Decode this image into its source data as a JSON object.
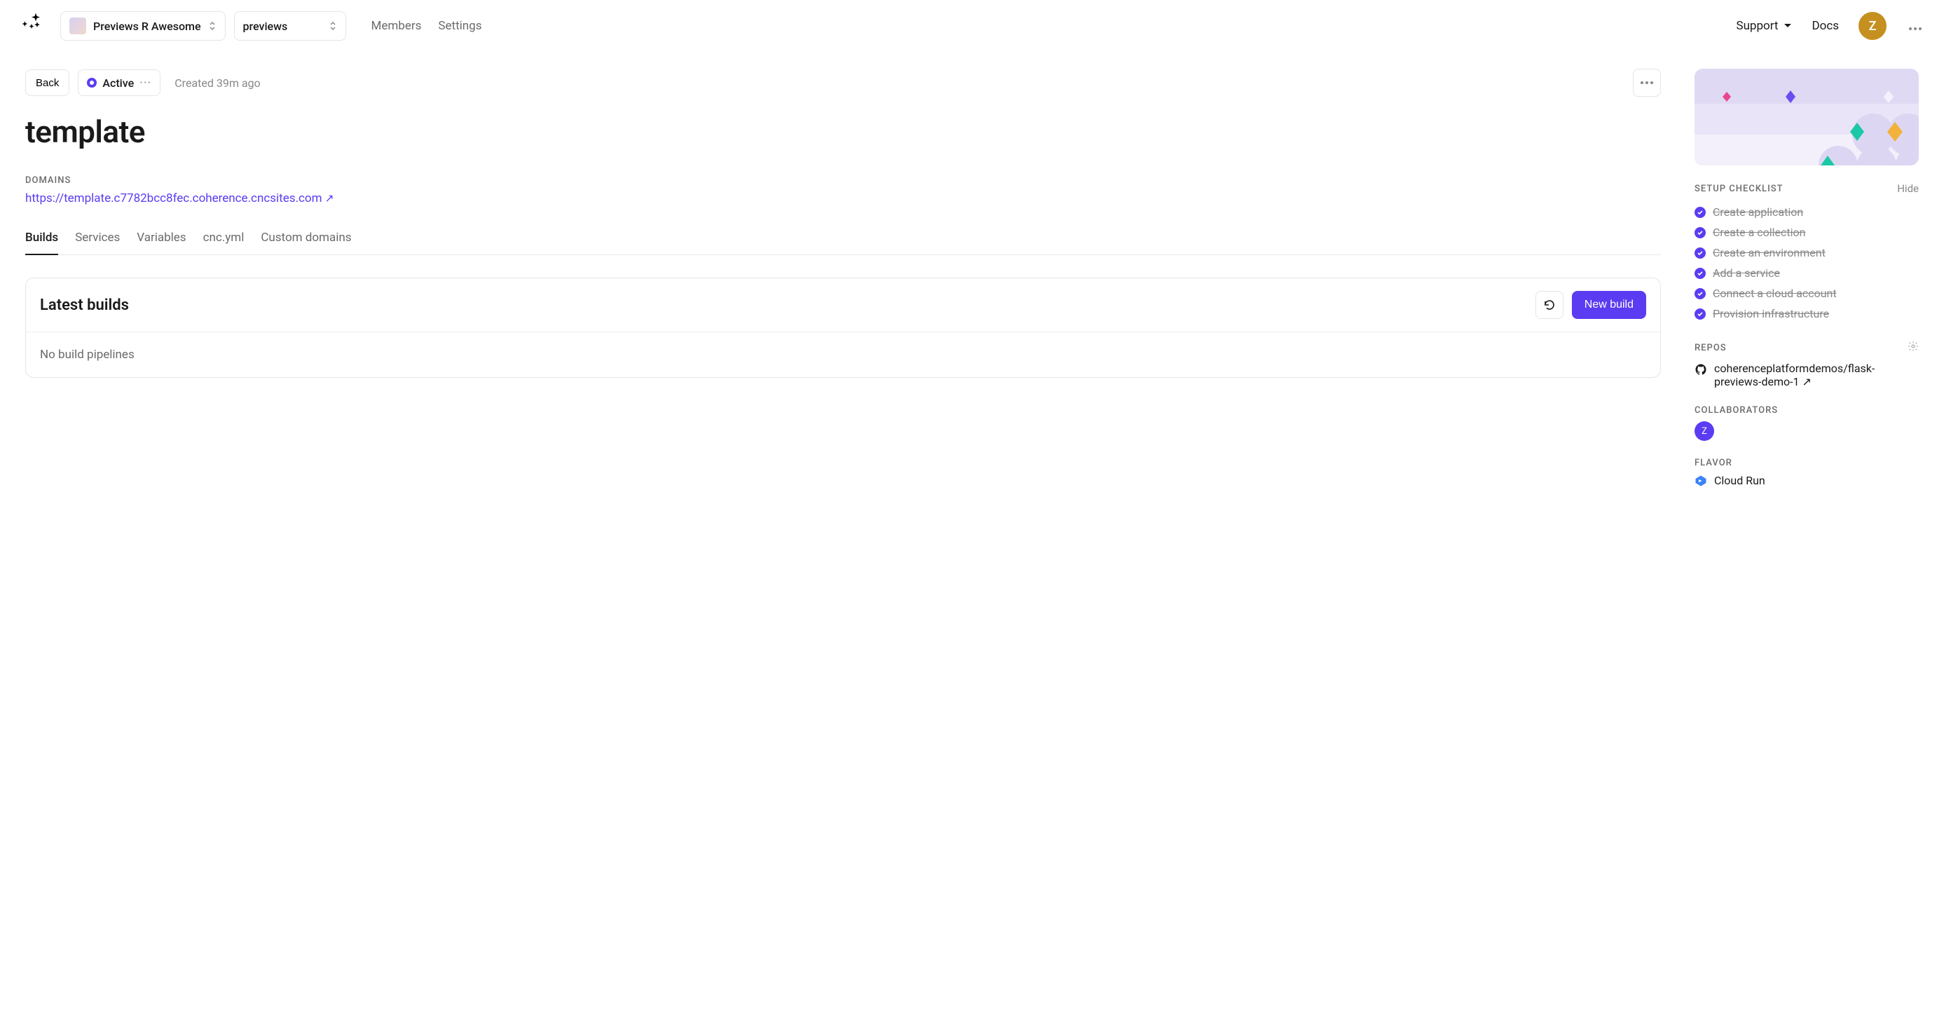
{
  "header": {
    "org_selector": "Previews R Awesome",
    "project_selector": "previews",
    "nav": {
      "members": "Members",
      "settings": "Settings"
    },
    "support": "Support",
    "docs": "Docs",
    "avatar_initial": "Z"
  },
  "toolbar": {
    "back": "Back",
    "status_label": "Active",
    "created": "Created 39m ago"
  },
  "page": {
    "title": "template",
    "domains_label": "DOMAINS",
    "domain_url": "https://template.c7782bcc8fec.coherence.cncsites.com"
  },
  "tabs": {
    "builds": "Builds",
    "services": "Services",
    "variables": "Variables",
    "cncyml": "cnc.yml",
    "custom_domains": "Custom domains"
  },
  "builds_card": {
    "title": "Latest builds",
    "new_build": "New build",
    "empty": "No build pipelines"
  },
  "sidebar": {
    "checklist_label": "SETUP CHECKLIST",
    "hide": "Hide",
    "checklist": [
      "Create application",
      "Create a collection",
      "Create an environment",
      "Add a service",
      "Connect a cloud account",
      "Provision infrastructure"
    ],
    "repos_label": "REPOS",
    "repo": "coherenceplatformdemos/flask-previews-demo-1",
    "collaborators_label": "COLLABORATORS",
    "collab_initial": "Z",
    "flavor_label": "FLAVOR",
    "flavor": "Cloud Run"
  }
}
